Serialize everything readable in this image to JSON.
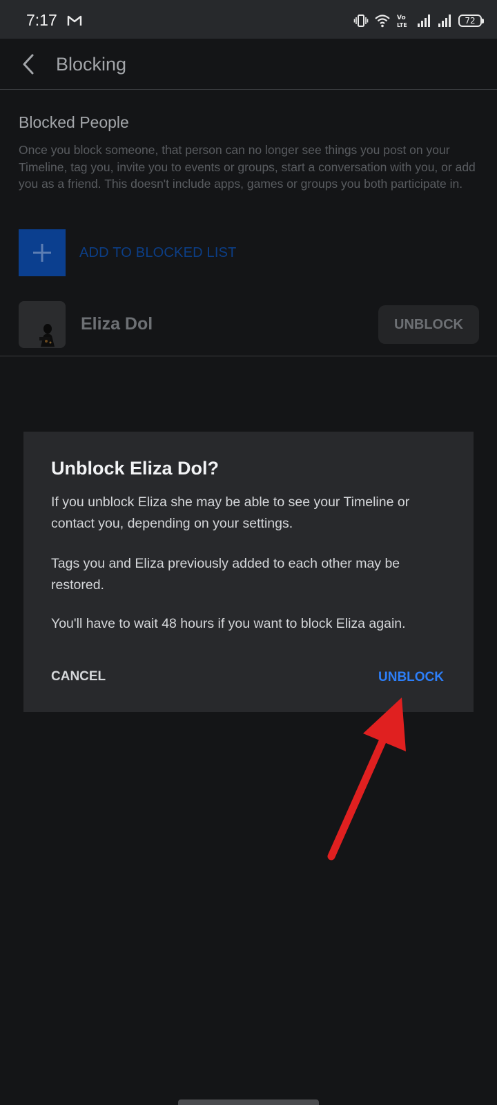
{
  "status_bar": {
    "time": "7:17",
    "battery_level": "72",
    "icons": [
      "gmail-icon",
      "vibrate-icon",
      "wifi-icon",
      "volte-icon",
      "signal-icon",
      "signal-icon",
      "battery-icon"
    ],
    "volte_text": [
      "Vo",
      "LTE"
    ]
  },
  "app_bar": {
    "back_icon": "chevron-left-icon",
    "title": "Blocking"
  },
  "blocked_section": {
    "title": "Blocked People",
    "description": "Once you block someone, that person can no longer see things you post on your Timeline, tag you, invite you to events or groups, start a conversation with you, or add you as a friend. This doesn't include apps, games or groups you both participate in.",
    "add_label": "ADD TO BLOCKED LIST",
    "add_icon": "plus-icon"
  },
  "blocked_list": [
    {
      "name": "Eliza Dol",
      "button_label": "UNBLOCK"
    }
  ],
  "dialog": {
    "title": "Unblock Eliza Dol?",
    "paragraphs": [
      "If you unblock Eliza she may be able to see your Timeline or contact you, depending on your settings.",
      "Tags you and Eliza previously added to each other may be restored.",
      "You'll have to wait 48 hours if you want to block Eliza again."
    ],
    "cancel_label": "CANCEL",
    "confirm_label": "UNBLOCK"
  },
  "colors": {
    "background": "#141517",
    "dialog_background": "#28292c",
    "accent_blue": "#2d7ff9",
    "add_blue": "#0b3f8f",
    "annotation_arrow": "#e02020"
  }
}
